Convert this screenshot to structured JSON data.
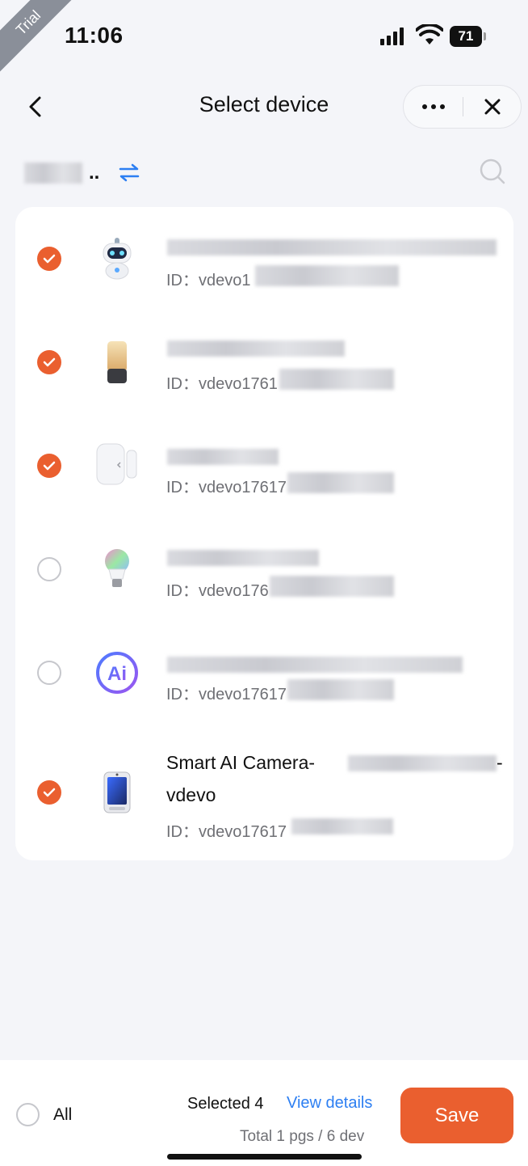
{
  "status_bar": {
    "trial_label": "Trial",
    "time": "11:06",
    "battery": "71",
    "signal_icon": "cellular-signal-icon",
    "wifi_icon": "wifi-icon"
  },
  "nav": {
    "title": "Select device",
    "back_icon": "chevron-left-icon",
    "more_icon": "more-icon",
    "close_icon": "close-icon"
  },
  "home_selector": {
    "dots": "..",
    "switch_icon": "switch-arrows-icon",
    "search_icon": "search-icon"
  },
  "devices": [
    {
      "checked": true,
      "icon": "robot-icon",
      "id_label": "ID：vdevo1"
    },
    {
      "checked": true,
      "icon": "smart-speaker-icon",
      "id_label": "ID：vdevo1761"
    },
    {
      "checked": true,
      "icon": "door-sensor-icon",
      "id_label": "ID：vdevo17617"
    },
    {
      "checked": false,
      "icon": "light-bulb-icon",
      "id_label": "ID：vdevo176"
    },
    {
      "checked": false,
      "icon": "ai-assistant-icon",
      "id_label": "ID：vdevo17617"
    },
    {
      "checked": true,
      "icon": "camera-device-icon",
      "name_line1": "Smart AI Camera-",
      "name_line1_end": "-",
      "name_line2": "vdevo",
      "id_label": "ID：vdevo17617"
    }
  ],
  "footer": {
    "all_label": "All",
    "selected_label": "Selected 4",
    "view_details": "View details",
    "total_label": "Total 1 pgs / 6 dev",
    "save_label": "Save"
  },
  "colors": {
    "accent": "#ea5f2f",
    "link": "#2d7ff2",
    "background": "#f4f5f9"
  }
}
